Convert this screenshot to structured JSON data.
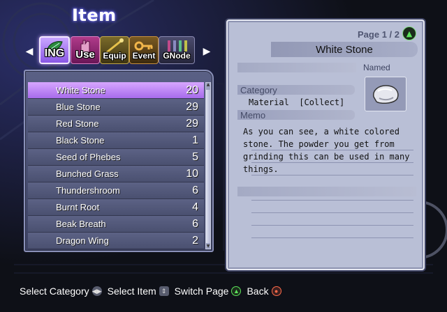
{
  "screen_title": "Item",
  "tabs": [
    {
      "label": "ING",
      "icon": "leaf-icon",
      "active": true
    },
    {
      "label": "Use",
      "icon": "hand-icon",
      "active": false
    },
    {
      "label": "Equip",
      "icon": "wand-icon",
      "active": false
    },
    {
      "label": "Event",
      "icon": "key-icon",
      "active": false
    },
    {
      "label": "GNode",
      "icon": "crystal-icon",
      "active": false
    }
  ],
  "items": [
    {
      "name": "White Stone",
      "qty": "20",
      "selected": true
    },
    {
      "name": "Blue Stone",
      "qty": "29"
    },
    {
      "name": "Red Stone",
      "qty": "29"
    },
    {
      "name": "Black Stone",
      "qty": "1"
    },
    {
      "name": "Seed of Phebes",
      "qty": "5"
    },
    {
      "name": "Bunched Grass",
      "qty": "10"
    },
    {
      "name": "Thundershroom",
      "qty": "6"
    },
    {
      "name": "Burnt Root",
      "qty": "4"
    },
    {
      "name": "Beak Breath",
      "qty": "6"
    },
    {
      "name": "Dragon Wing",
      "qty": "2"
    }
  ],
  "detail": {
    "page": "Page 1 / 2",
    "item_name": "White Stone",
    "named_label": "Named",
    "category_label": "Category",
    "category_value": "Material  [Collect]",
    "memo_label": "Memo",
    "memo_text": "As you can see, a white colored stone. The powder you get from grinding this can be used in many things.",
    "icon": "white-stone-icon"
  },
  "footer": {
    "select_category": "Select Category",
    "select_item": "Select Item",
    "switch_page": "Switch Page",
    "back": "Back"
  },
  "colors": {
    "selected_row": "#c08cff",
    "list_row": "#555b7e",
    "detail_bg": "#b9bfd6",
    "triangle_green": "#5be35b",
    "circle_red": "#ff6b4a"
  }
}
